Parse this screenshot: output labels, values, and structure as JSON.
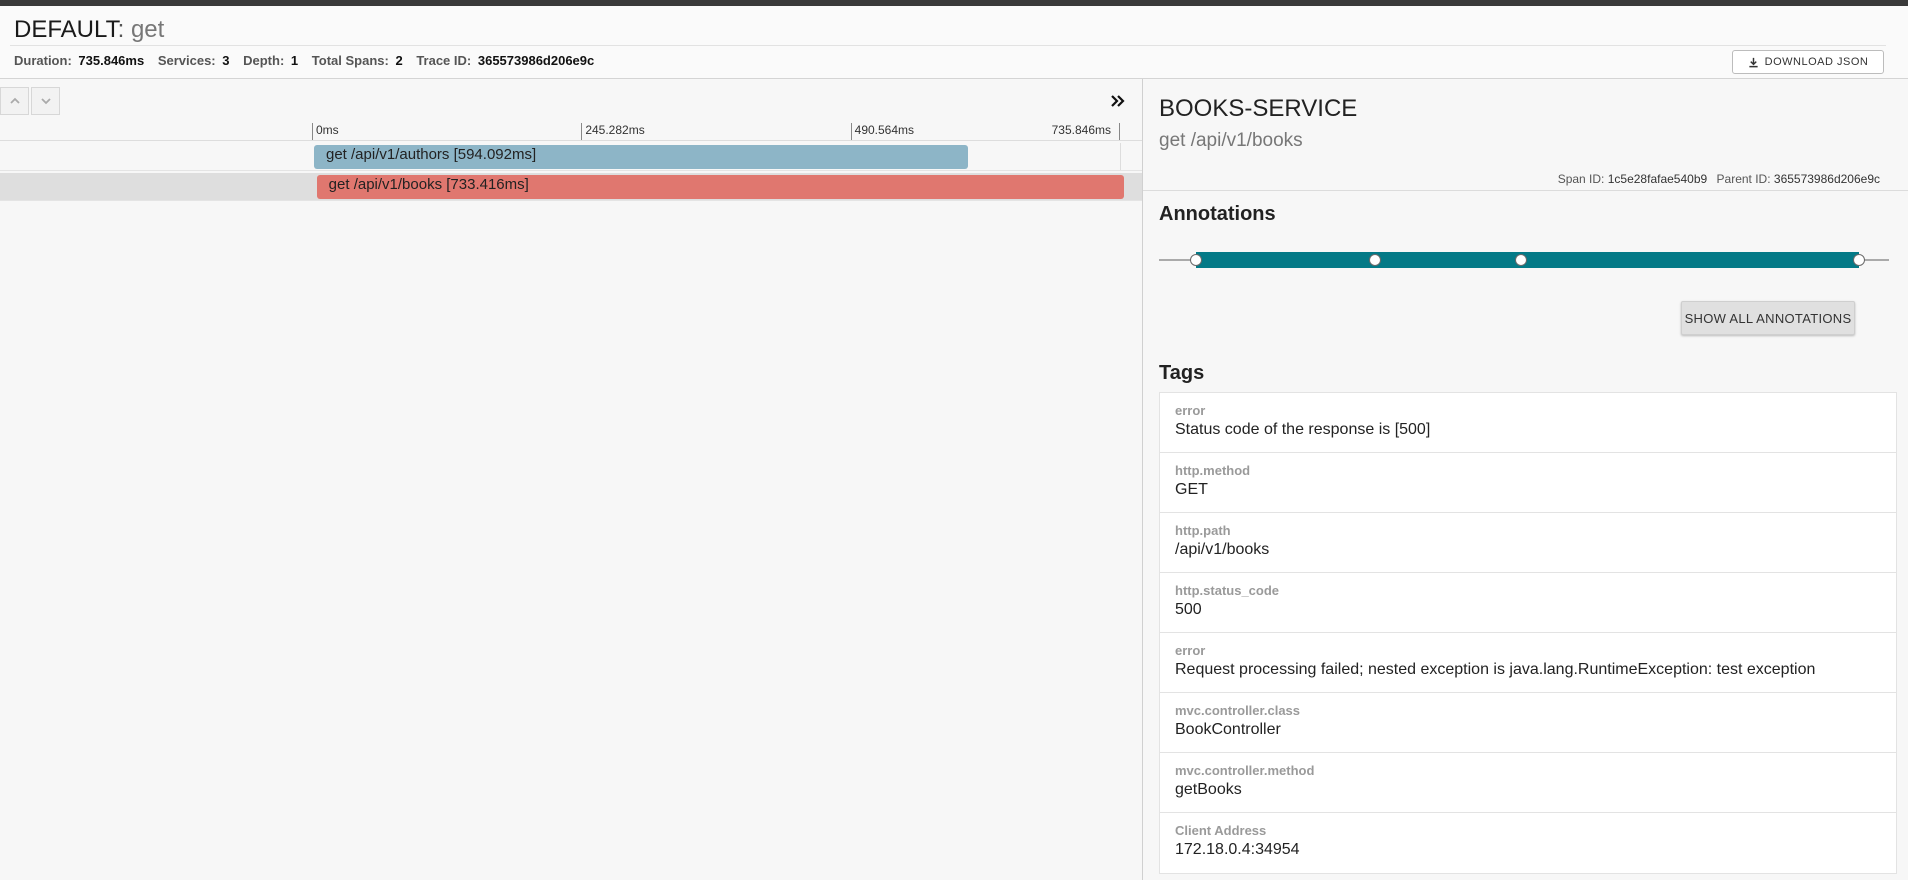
{
  "header": {
    "service": "DEFAULT",
    "separator": ": ",
    "operation": "get",
    "meta": {
      "duration_label": "Duration:",
      "duration": "735.846ms",
      "services_label": "Services:",
      "services": "3",
      "depth_label": "Depth:",
      "depth": "1",
      "spans_label": "Total Spans:",
      "spans": "2",
      "trace_label": "Trace ID:",
      "trace_id": "365573986d206e9c"
    },
    "download_label": "DOWNLOAD JSON",
    "download_icon": "download-icon"
  },
  "timeline": {
    "nav_up_icon": "chevron-up-icon",
    "nav_down_icon": "chevron-down-icon",
    "expand_icon": "double-chevron-right-icon",
    "total_ms": 735.846,
    "ticks": [
      "0ms",
      "245.282ms",
      "490.564ms",
      "735.846ms"
    ],
    "spans": [
      {
        "label": "get /api/v1/authors [594.092ms]",
        "start_ms": 0,
        "duration_ms": 594.092,
        "color": "#8db5c7",
        "selected": false
      },
      {
        "label": "get /api/v1/books [733.416ms]",
        "start_ms": 2.43,
        "duration_ms": 733.416,
        "color": "#e0776f",
        "selected": true
      }
    ]
  },
  "detail": {
    "service": "BOOKS-SERVICE",
    "span_name": "get /api/v1/books",
    "span_id_label": "Span ID:",
    "span_id": "1c5e28fafae540b9",
    "parent_id_label": "Parent ID:",
    "parent_id": "365573986d206e9c",
    "annotations_title": "Annotations",
    "annotation_color": "#047a87",
    "annotation_positions": [
      0,
      0.27,
      0.49,
      1
    ],
    "show_all_label": "SHOW ALL ANNOTATIONS",
    "tags_title": "Tags",
    "tags": [
      {
        "key": "error",
        "value": "Status code of the response is [500]"
      },
      {
        "key": "http.method",
        "value": "GET"
      },
      {
        "key": "http.path",
        "value": "/api/v1/books"
      },
      {
        "key": "http.status_code",
        "value": "500"
      },
      {
        "key": "error",
        "value": "Request processing failed; nested exception is java.lang.RuntimeException: test exception"
      },
      {
        "key": "mvc.controller.class",
        "value": "BookController"
      },
      {
        "key": "mvc.controller.method",
        "value": "getBooks"
      },
      {
        "key": "Client Address",
        "value": "172.18.0.4:34954"
      }
    ]
  }
}
